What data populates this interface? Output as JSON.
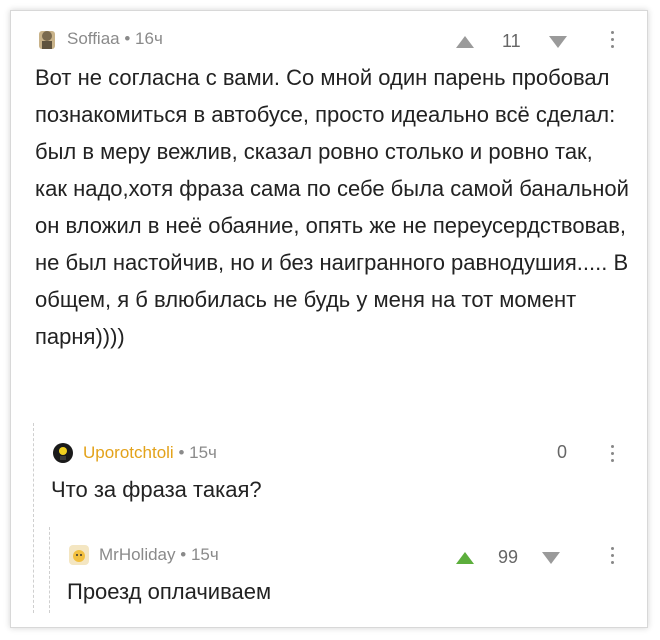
{
  "comments": [
    {
      "author": "Soffiaa",
      "time": "16ч",
      "rating": "11",
      "text": "Вот не согласна с вами. Со мной один парень пробовал познакомиться в автобусе, просто идеально всё сделал: был в меру вежлив, сказал ровно столько и ровно так, как надо,хотя фраза сама по себе была самой банальной он вложил в неё обаяние, опять же не переусердствовав, не был настойчив, но и без наигранного равнодушия..... В общем, я б влюбилась не будь у меня на тот момент парня))))"
    },
    {
      "author": "Uporotchtoli",
      "time": "15ч",
      "rating": "0",
      "text": "Что за фраза такая?"
    },
    {
      "author": "MrHoliday",
      "time": "15ч",
      "rating": "99",
      "text": "Проезд оплачиваем"
    }
  ],
  "colors": {
    "orange_author": "#e3a21a",
    "upvote_green": "#5cae3c",
    "meta_gray": "#8a8a8a"
  }
}
